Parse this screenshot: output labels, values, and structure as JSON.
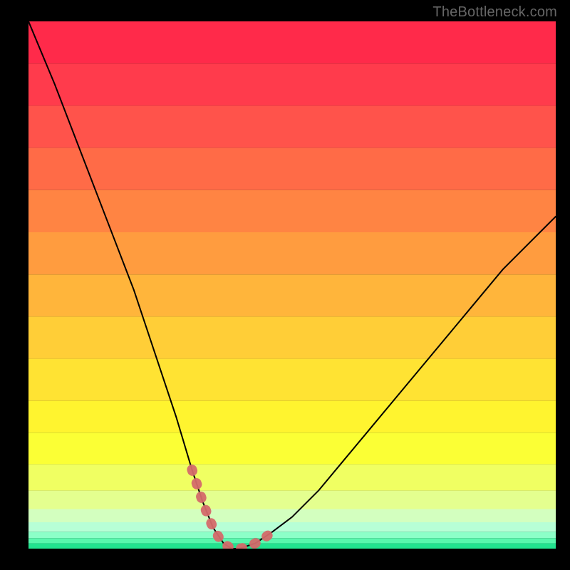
{
  "watermark": "TheBottleneck.com",
  "chart_data": {
    "type": "line",
    "title": "",
    "xlabel": "",
    "ylabel": "",
    "xlim": [
      0,
      100
    ],
    "ylim": [
      0,
      100
    ],
    "series": [
      {
        "name": "bottleneck-curve",
        "x": [
          0,
          5,
          10,
          15,
          20,
          24,
          28,
          31,
          33,
          35,
          37,
          38.5,
          40,
          43,
          46,
          50,
          55,
          60,
          65,
          70,
          75,
          80,
          85,
          90,
          95,
          100
        ],
        "values": [
          100,
          88,
          75,
          62,
          49,
          37,
          25,
          15,
          9,
          4,
          1,
          0,
          0,
          1,
          3,
          6,
          11,
          17,
          23,
          29,
          35,
          41,
          47,
          53,
          58,
          63
        ]
      }
    ],
    "highlight": {
      "name": "valley-highlight",
      "color": "#d46a6a",
      "x": [
        31,
        32,
        33,
        34,
        35,
        36,
        37,
        38,
        38.5,
        39,
        40,
        41,
        42,
        43,
        44,
        45,
        46
      ],
      "values": [
        15,
        12,
        9,
        6.3,
        4,
        2.3,
        1,
        0.3,
        0,
        0,
        0,
        0.2,
        0.6,
        1,
        1.6,
        2.2,
        3
      ]
    },
    "background_bands": [
      {
        "from_y": 92,
        "to_y": 100,
        "color": "#ff2a4a"
      },
      {
        "from_y": 84,
        "to_y": 92,
        "color": "#ff3b4c"
      },
      {
        "from_y": 76,
        "to_y": 84,
        "color": "#ff534b"
      },
      {
        "from_y": 68,
        "to_y": 76,
        "color": "#ff6b47"
      },
      {
        "from_y": 60,
        "to_y": 68,
        "color": "#ff8443"
      },
      {
        "from_y": 52,
        "to_y": 60,
        "color": "#ff9c3f"
      },
      {
        "from_y": 44,
        "to_y": 52,
        "color": "#ffb53b"
      },
      {
        "from_y": 36,
        "to_y": 44,
        "color": "#ffce37"
      },
      {
        "from_y": 28,
        "to_y": 36,
        "color": "#ffe333"
      },
      {
        "from_y": 22,
        "to_y": 28,
        "color": "#fff42f"
      },
      {
        "from_y": 16,
        "to_y": 22,
        "color": "#fbff35"
      },
      {
        "from_y": 11,
        "to_y": 16,
        "color": "#f0ff62"
      },
      {
        "from_y": 7.5,
        "to_y": 11,
        "color": "#e4ff8f"
      },
      {
        "from_y": 5.0,
        "to_y": 7.5,
        "color": "#d3ffbf"
      },
      {
        "from_y": 3.2,
        "to_y": 5.0,
        "color": "#b7ffd6"
      },
      {
        "from_y": 2.0,
        "to_y": 3.2,
        "color": "#8cffc8"
      },
      {
        "from_y": 1.0,
        "to_y": 2.0,
        "color": "#58f7ad"
      },
      {
        "from_y": 0,
        "to_y": 1.0,
        "color": "#22e38f"
      }
    ]
  }
}
